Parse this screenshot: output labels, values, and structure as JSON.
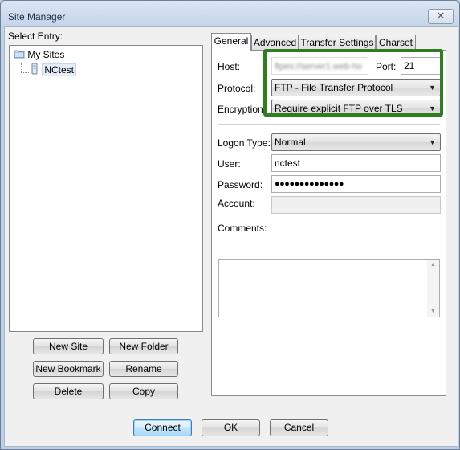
{
  "window": {
    "title": "Site Manager",
    "close_glyph": "✕"
  },
  "left": {
    "select_entry_label": "Select Entry:",
    "tree": [
      {
        "label": "My Sites",
        "icon": "folder-icon"
      },
      {
        "label": "NCtest",
        "icon": "server-icon",
        "selected": true
      }
    ],
    "buttons": {
      "new_site": "New Site",
      "new_folder": "New Folder",
      "new_bookmark": "New Bookmark",
      "rename": "Rename",
      "delete": "Delete",
      "copy": "Copy"
    }
  },
  "tabs": [
    "General",
    "Advanced",
    "Transfer Settings",
    "Charset"
  ],
  "active_tab": "General",
  "general": {
    "host_label": "Host:",
    "host_value": "ftpes://server1.web-ho",
    "port_label": "Port:",
    "port_value": "21",
    "protocol_label": "Protocol:",
    "protocol_value": "FTP - File Transfer Protocol",
    "encryption_label": "Encryption:",
    "encryption_value": "Require explicit FTP over TLS",
    "logon_type_label": "Logon Type:",
    "logon_type_value": "Normal",
    "user_label": "User:",
    "user_value": "nctest",
    "password_label": "Password:",
    "password_value": "●●●●●●●●●●●●●●",
    "account_label": "Account:",
    "account_value": "",
    "comments_label": "Comments:",
    "comments_value": ""
  },
  "footer": {
    "connect": "Connect",
    "ok": "OK",
    "cancel": "Cancel"
  },
  "colors": {
    "highlight_border": "#2e7d1f",
    "window_frame": "#bcd0e8"
  }
}
